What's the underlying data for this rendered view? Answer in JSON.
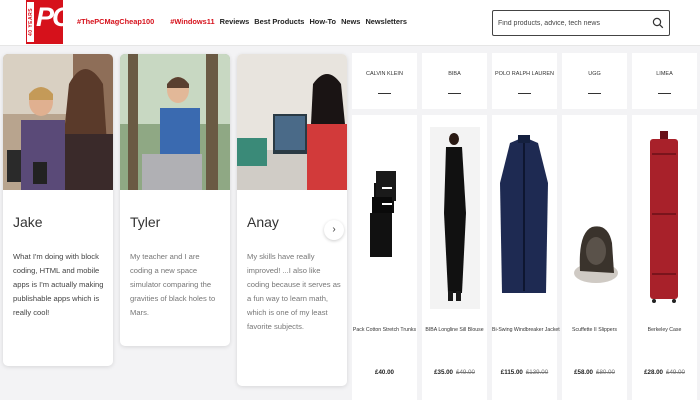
{
  "header": {
    "logo_text": "PC",
    "logo_years": "40 YEARS",
    "nav": [
      {
        "label": "#ThePCMagCheap100",
        "highlight": true
      },
      {
        "label": "#Windows11",
        "highlight": true
      },
      {
        "label": "Reviews",
        "highlight": false
      },
      {
        "label": "Best Products",
        "highlight": false
      },
      {
        "label": "How-To",
        "highlight": false
      },
      {
        "label": "News",
        "highlight": false
      },
      {
        "label": "Newsletters",
        "highlight": false
      }
    ],
    "search_placeholder": "Find products, advice, tech news",
    "accent_color": "#d6111b"
  },
  "testimonials": [
    {
      "name": "Jake",
      "quote": "What I'm doing with block coding, HTML and mobile apps is I'm actually making publishable apps which is really cool!"
    },
    {
      "name": "Tyler",
      "quote": "My teacher and I are coding a new space simulator comparing the gravities of black holes to Mars."
    },
    {
      "name": "Anay",
      "quote": "My skills have really improved! ...I also like coding because it serves as a fun way to learn math, which is one of my least favorite subjects."
    }
  ],
  "carousel_next": "›",
  "products": [
    {
      "brand": "CALVIN KLEIN",
      "name": "Pack Cotton Stretch Trunks",
      "price": "£40.00",
      "old_price": ""
    },
    {
      "brand": "BIBA",
      "name": "BIBA Longline Sill Blouse",
      "price": "£35.00",
      "old_price": "£49.00"
    },
    {
      "brand": "POLO RALPH LAUREN",
      "name": "Bi-Swing Windbreaker Jacket",
      "price": "£115.00",
      "old_price": "£139.00"
    },
    {
      "brand": "UGG",
      "name": "Scuffette II Slippers",
      "price": "£58.00",
      "old_price": "£80.00"
    },
    {
      "brand": "LIMEA",
      "name": "Berkeley Case",
      "price": "£28.00",
      "old_price": "£49.00"
    }
  ]
}
